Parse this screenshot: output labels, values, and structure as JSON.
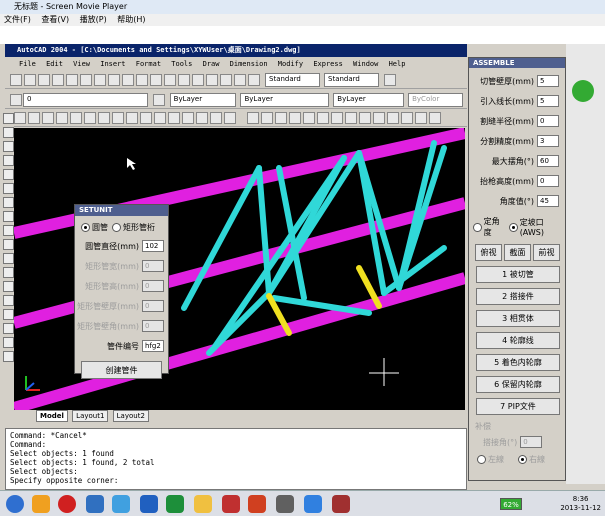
{
  "player": {
    "title": "无标题 - Screen Movie Player",
    "menu": [
      "文件(F)",
      "查看(V)",
      "播放(P)",
      "帮助(H)"
    ]
  },
  "acad": {
    "title": "AutoCAD 2004 - [C:\\Documents and Settings\\XYWUser\\桌面\\Drawing2.dwg]",
    "menu": [
      "File",
      "Edit",
      "View",
      "Insert",
      "Format",
      "Tools",
      "Draw",
      "Dimension",
      "Modify",
      "Express",
      "Window",
      "Help"
    ],
    "style_combo1": "Standard",
    "style_combo2": "Standard",
    "layer_combo": "0",
    "color_combo": "ByLayer",
    "linetype_combo": "ByLayer",
    "lineweight_combo": "ByLayer",
    "plotstyle_combo": "ByColor",
    "tabs": [
      "Model",
      "Layout1",
      "Layout2"
    ],
    "command_lines": [
      "Command: *Cancel*",
      "Command:",
      "Select objects: 1 found",
      "Select objects: 1 found, 2 total",
      "Select objects:",
      "Specify opposite corner:"
    ]
  },
  "setunit": {
    "title": "SETUNIT",
    "radio_round": "圆管",
    "radio_rect": "矩形管桁",
    "fields": [
      {
        "label": "圆管直径(mm)",
        "value": "102",
        "enabled": true
      },
      {
        "label": "矩形管宽(mm)",
        "value": "0",
        "enabled": false
      },
      {
        "label": "矩形管高(mm)",
        "value": "0",
        "enabled": false
      },
      {
        "label": "矩形管壁厚(mm)",
        "value": "0",
        "enabled": false
      },
      {
        "label": "矩形管壁角(mm)",
        "value": "0",
        "enabled": false
      },
      {
        "label": "管件编号",
        "value": "hfg2",
        "enabled": true
      }
    ],
    "create_button": "创建管件"
  },
  "assemble": {
    "title": "ASSEMBLE",
    "fields": [
      {
        "label": "切管壁厚(mm)",
        "value": "5"
      },
      {
        "label": "引入线长(mm)",
        "value": "5"
      },
      {
        "label": "割缝半径(mm)",
        "value": "0"
      },
      {
        "label": "分割精度(mm)",
        "value": "3"
      },
      {
        "label": "最大摆角(°)",
        "value": "60"
      },
      {
        "label": "抬枪高度(mm)",
        "value": "0"
      },
      {
        "label": "角度值(°)",
        "value": "45"
      }
    ],
    "radio_fixed_angle": "定角度",
    "radio_fixed_gap": "定坡口(AWS)",
    "view_buttons": [
      "俯视",
      "截面",
      "前视"
    ],
    "steps": [
      "1 被切管",
      "2 搭接件",
      "3 相贯体",
      "4 轮廓线",
      "5 着色内轮廓",
      "6 保留内轮廓",
      "7 PIP文件"
    ],
    "supplement_label": "补偿",
    "supplement_field": "搭接角(°)",
    "supplement_value": "0",
    "radio_left": "左線",
    "radio_right": "右線"
  },
  "taskbar": {
    "battery": "62%",
    "time": "8:36",
    "date": "2013-11-12"
  },
  "colors": {
    "magenta": "#e020e0",
    "cyan": "#30d8d8",
    "yellow": "#f0e020",
    "titlebar": "#0a246a"
  }
}
